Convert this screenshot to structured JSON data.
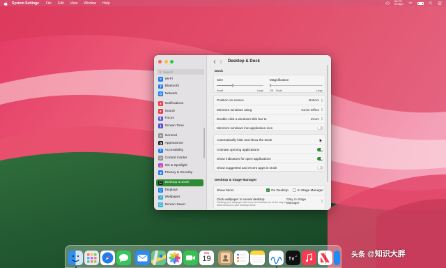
{
  "menubar": {
    "app_name": "System Settings",
    "items": [
      "File",
      "Edit",
      "View",
      "Window",
      "Help"
    ],
    "weather_line1": "DB PSI",
    "weather_line2": "Wenfgen"
  },
  "window": {
    "title": "Desktop & Dock",
    "search_placeholder": "Search"
  },
  "sidebar": {
    "items": [
      {
        "label": "Wi-Fi",
        "icon": "wifi-icon",
        "color": "#1e7cf0"
      },
      {
        "label": "Bluetooth",
        "icon": "bluetooth-icon",
        "color": "#1e7cf0"
      },
      {
        "label": "Network",
        "icon": "globe-icon",
        "color": "#1e7cf0"
      },
      {
        "label": "Notifications",
        "icon": "bell-icon",
        "color": "#ee3a43"
      },
      {
        "label": "Sound",
        "icon": "speaker-icon",
        "color": "#ee3a43"
      },
      {
        "label": "Focus",
        "icon": "moon-icon",
        "color": "#5b4bd6"
      },
      {
        "label": "Screen Time",
        "icon": "hourglass-icon",
        "color": "#5b4bd6"
      },
      {
        "label": "General",
        "icon": "gear-icon",
        "color": "#8e8e93"
      },
      {
        "label": "Appearance",
        "icon": "appearance-icon",
        "color": "#1b1b1b"
      },
      {
        "label": "Accessibility",
        "icon": "accessibility-icon",
        "color": "#1e7cf0"
      },
      {
        "label": "Control Center",
        "icon": "control-center-icon",
        "color": "#8e8e93"
      },
      {
        "label": "Siri & Spotlight",
        "icon": "siri-icon",
        "color": "#c13ad1"
      },
      {
        "label": "Privacy & Security",
        "icon": "hand-icon",
        "color": "#1e7cf0"
      },
      {
        "label": "Desktop & Dock",
        "icon": "dock-icon",
        "color": "#1b1b1b"
      },
      {
        "label": "Displays",
        "icon": "display-icon",
        "color": "#1e7cf0"
      },
      {
        "label": "Wallpaper",
        "icon": "wallpaper-icon",
        "color": "#2aa7e6"
      },
      {
        "label": "Screen Saver",
        "icon": "screensaver-icon",
        "color": "#36b7d8"
      }
    ],
    "active_index": 13
  },
  "dock_section": {
    "title": "Dock",
    "size_label": "Size",
    "size_min": "Small",
    "size_max": "Large",
    "size_value": 0.34,
    "magnification_label": "Magnification",
    "mag_off": "Off",
    "mag_min": "Small",
    "mag_max": "Large",
    "magnification_value": 0.0,
    "rows": [
      {
        "label": "Position on screen",
        "value": "Bottom"
      },
      {
        "label": "Minimize windows using",
        "value": "Genie Effect"
      },
      {
        "label": "Double-click a window's title bar to",
        "value": "Zoom"
      }
    ],
    "toggles": [
      {
        "label": "Minimize windows into application icon",
        "on": false
      },
      {
        "label": "Automatically hide and show the Dock",
        "on": false
      },
      {
        "label": "Animate opening applications",
        "on": true
      },
      {
        "label": "Show indicators for open applications",
        "on": true
      },
      {
        "label": "Show suggested and recent apps in Dock",
        "on": false
      }
    ]
  },
  "stage_section": {
    "title": "Desktop & Stage Manager",
    "show_items_label": "Show Items",
    "on_desktop_label": "On Desktop",
    "on_desktop_checked": true,
    "in_stage_label": "In Stage Manager",
    "in_stage_checked": false,
    "click_label": "Click wallpaper to reveal desktop",
    "click_value": "Only in Stage Manager",
    "click_sub": "Clicking your wallpaper will move all windows out of the way to allow access to your desktop items"
  },
  "dock": {
    "calendar_month": "FEB",
    "calendar_day": "19",
    "apps": [
      {
        "name": "finder-icon",
        "color": "#2f8ff0"
      },
      {
        "name": "launchpad-icon",
        "color": "#e9e9ee"
      },
      {
        "name": "safari-icon",
        "color": "#1e7cf0"
      },
      {
        "name": "messages-icon",
        "color": "#35c759"
      },
      {
        "name": "mail-icon",
        "color": "#2a8bf2"
      },
      {
        "name": "maps-icon",
        "color": "#6cc28a"
      },
      {
        "name": "photos-icon",
        "color": "#ffffff"
      },
      {
        "name": "facetime-icon",
        "color": "#33c151"
      },
      {
        "name": "calendar-icon",
        "color": "#ffffff"
      },
      {
        "name": "contacts-icon",
        "color": "#c69a66"
      },
      {
        "name": "reminders-icon",
        "color": "#ffffff"
      },
      {
        "name": "notes-icon",
        "color": "#ffffff"
      },
      {
        "name": "freeform-icon",
        "color": "#ffffff"
      },
      {
        "name": "tv-icon",
        "color": "#111111"
      },
      {
        "name": "music-icon",
        "color": "#fb3a52"
      },
      {
        "name": "news-icon",
        "color": "#ffffff"
      },
      {
        "name": "app-store-icon",
        "color": "#1c8bf5"
      },
      {
        "name": "downloads-icon",
        "color": "#8a8a8a"
      }
    ]
  },
  "watermark": {
    "brand": "头条",
    "handle": "@知识大胖"
  }
}
